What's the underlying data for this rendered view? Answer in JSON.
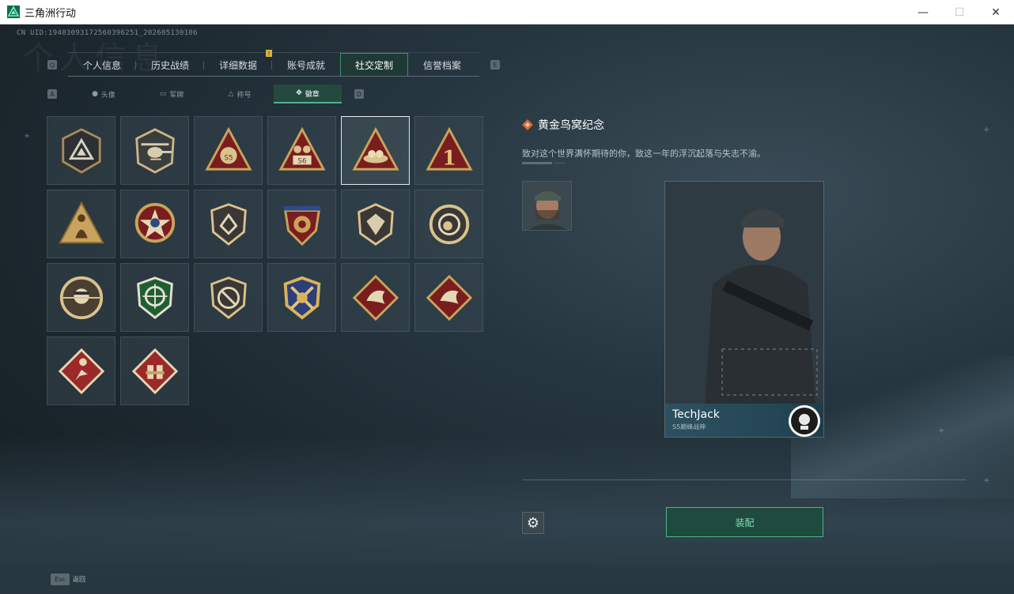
{
  "window": {
    "title": "三角洲行动",
    "minimize": "—",
    "maximize": "☐",
    "close": "✕"
  },
  "uid": "CN UID:19403093172560396251_202605130106",
  "watermark": "个人信息",
  "tabs": {
    "prev_key": "Q",
    "next_key": "E",
    "items": [
      {
        "label": "个人信息"
      },
      {
        "label": "历史战绩"
      },
      {
        "label": "详细数据"
      },
      {
        "label": "账号成就"
      },
      {
        "label": "社交定制",
        "active": true
      },
      {
        "label": "信誉档案"
      }
    ],
    "alert_badge": "!"
  },
  "subtabs": {
    "prev_key": "A",
    "next_key": "D",
    "items": [
      {
        "label": "头像",
        "icon": "person-icon"
      },
      {
        "label": "军牌",
        "icon": "dogtag-icon"
      },
      {
        "label": "称号",
        "icon": "title-icon"
      },
      {
        "label": "徽章",
        "icon": "emblem-icon",
        "active": true
      }
    ]
  },
  "emblems": [
    {
      "name": "delta-triangle-emblem"
    },
    {
      "name": "helicopter-emblem"
    },
    {
      "name": "s5-sack-emblem"
    },
    {
      "name": "s6-crown-emblem"
    },
    {
      "name": "golden-nest-emblem",
      "selected": true
    },
    {
      "name": "number-one-emblem"
    },
    {
      "name": "figure-triangle-emblem"
    },
    {
      "name": "star-shield-emblem"
    },
    {
      "name": "wing-shield-emblem"
    },
    {
      "name": "blue-crest-emblem"
    },
    {
      "name": "diamond-shield-emblem"
    },
    {
      "name": "ring-emblem"
    },
    {
      "name": "masked-operator-emblem"
    },
    {
      "name": "green-crosshair-emblem"
    },
    {
      "name": "no-weapon-emblem"
    },
    {
      "name": "crossed-rifles-emblem"
    },
    {
      "name": "red-dragon-emblem"
    },
    {
      "name": "red-dragon-emblem-2"
    },
    {
      "name": "runner-emblem"
    },
    {
      "name": "supply-emblem"
    }
  ],
  "detail": {
    "title": "黄金鸟窝纪念",
    "description": "致对这个世界满怀期待的你，致这一年的浮沉起落与失志不渝。"
  },
  "card": {
    "player_name": "TechJack",
    "subtitle": "S5巅峰战神"
  },
  "actions": {
    "equip_label": "装配",
    "settings_icon": "gear-icon"
  },
  "footer": {
    "esc_key": "Esc",
    "back_label": "返回"
  },
  "colors": {
    "accent_green": "#4fb48c",
    "gold": "#c9a35b",
    "crimson": "#7a1d1f"
  }
}
